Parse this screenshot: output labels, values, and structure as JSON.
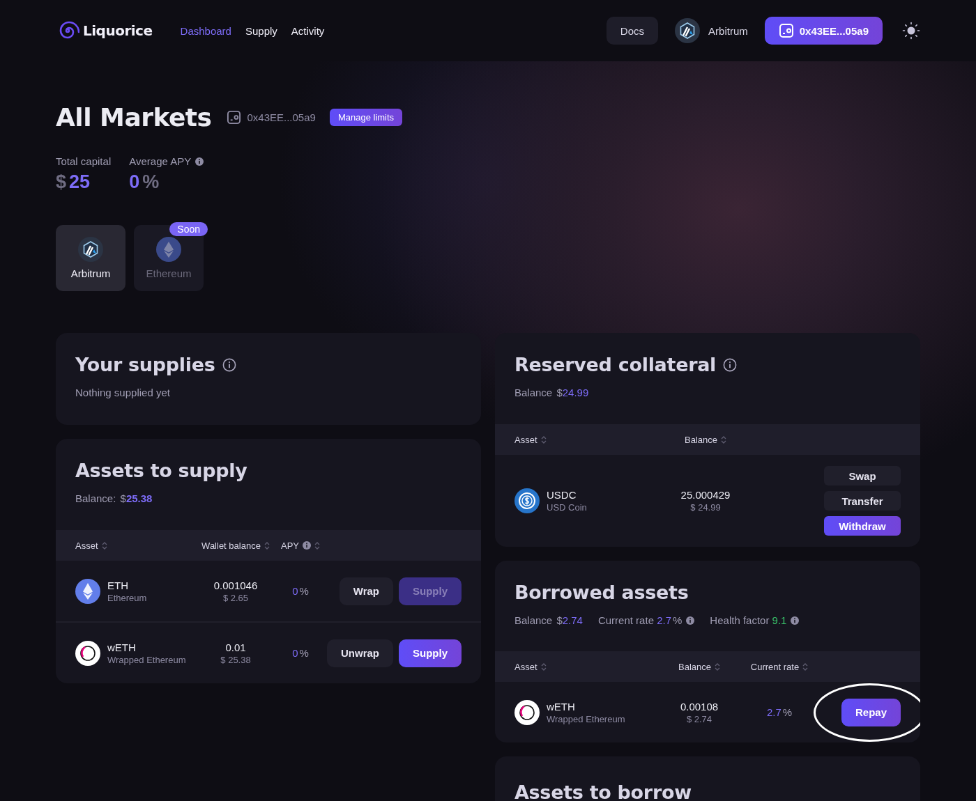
{
  "nav": {
    "brand": "Liquorice",
    "links": [
      {
        "label": "Dashboard",
        "selected": true
      },
      {
        "label": "Supply",
        "selected": false
      },
      {
        "label": "Activity",
        "selected": false
      }
    ],
    "docs": "Docs",
    "network": "Arbitrum",
    "wallet": "0x43EE...05a9"
  },
  "header": {
    "title": "All Markets",
    "address": "0x43EE...05a9",
    "action": "Manage limits"
  },
  "stats": [
    {
      "label": "Total capital",
      "info": false,
      "prefix": "$",
      "value": "25"
    },
    {
      "label": "Average APY",
      "info": true,
      "value": "0",
      "suffix": "%"
    }
  ],
  "networks": [
    {
      "label": "Arbitrum",
      "kind": "arbitrum",
      "selected": true,
      "disabled": false
    },
    {
      "label": "Ethereum",
      "kind": "eth",
      "selected": false,
      "disabled": true,
      "badge": "Soon"
    }
  ],
  "supplies": {
    "title": "Your supplies",
    "info": true,
    "text": "Nothing supplied yet"
  },
  "assets_to_supply": {
    "title": "Assets to supply",
    "balance_label": "Balance:",
    "currency": "$",
    "balance": "25.38",
    "columns": [
      {
        "label": "Asset",
        "info": false
      },
      {
        "label": "Wallet balance",
        "info": false
      },
      {
        "label": "APY",
        "info": true
      }
    ],
    "rows": [
      {
        "kind": "eth",
        "symbol": "ETH",
        "name": "Ethereum",
        "amount": "0.001046",
        "usd": "$ 2.65",
        "apy": "0",
        "apy_suffix": "%",
        "buttons": [
          {
            "label": "Wrap",
            "kind": "secondary",
            "disabled": false
          },
          {
            "label": "Supply",
            "kind": "primary",
            "disabled": true
          }
        ]
      },
      {
        "kind": "weth",
        "symbol": "wETH",
        "name": "Wrapped Ethereum",
        "amount": "0.01",
        "usd": "$ 25.38",
        "apy": "0",
        "apy_suffix": "%",
        "buttons": [
          {
            "label": "Unwrap",
            "kind": "secondary",
            "disabled": false
          },
          {
            "label": "Supply",
            "kind": "primary",
            "disabled": false
          }
        ]
      }
    ]
  },
  "reserved": {
    "title": "Reserved collateral",
    "info": true,
    "balance_label": "Balance",
    "currency": "$",
    "balance": "24.99",
    "columns": [
      {
        "label": "Asset"
      },
      {
        "label": "Balance"
      }
    ],
    "rows": [
      {
        "kind": "usdc",
        "symbol": "USDC",
        "name": "USD Coin",
        "amount": "25.000429",
        "usd": "$ 24.99",
        "buttons": [
          {
            "label": "Swap",
            "kind": "secondary",
            "disabled": false
          },
          {
            "label": "Transfer",
            "kind": "secondary",
            "disabled": false
          },
          {
            "label": "Withdraw",
            "kind": "primary",
            "disabled": false
          }
        ]
      }
    ]
  },
  "borrowed": {
    "title": "Borrowed assets",
    "stats": [
      {
        "label": "Balance",
        "prefix": "$",
        "value": "2.74",
        "color": "#7d6cf7",
        "info": false
      },
      {
        "label": "Current rate",
        "value": "2.7",
        "suffix": "%",
        "color": "#7d6cf7",
        "info": true
      },
      {
        "label": "Health factor",
        "value": "9.1",
        "color": "#39c26a",
        "info": true
      }
    ],
    "columns": [
      {
        "label": "Asset"
      },
      {
        "label": "Balance"
      },
      {
        "label": "Current rate"
      }
    ],
    "rows": [
      {
        "kind": "weth",
        "symbol": "wETH",
        "name": "Wrapped Ethereum",
        "amount": "0.00108",
        "usd": "$ 2.74",
        "rate": "2.7",
        "rate_suffix": "%",
        "buttons": [
          {
            "label": "Repay",
            "kind": "primary",
            "disabled": false,
            "highlighted": true
          }
        ]
      }
    ]
  },
  "assets_to_borrow": {
    "title": "Assets to borrow"
  }
}
